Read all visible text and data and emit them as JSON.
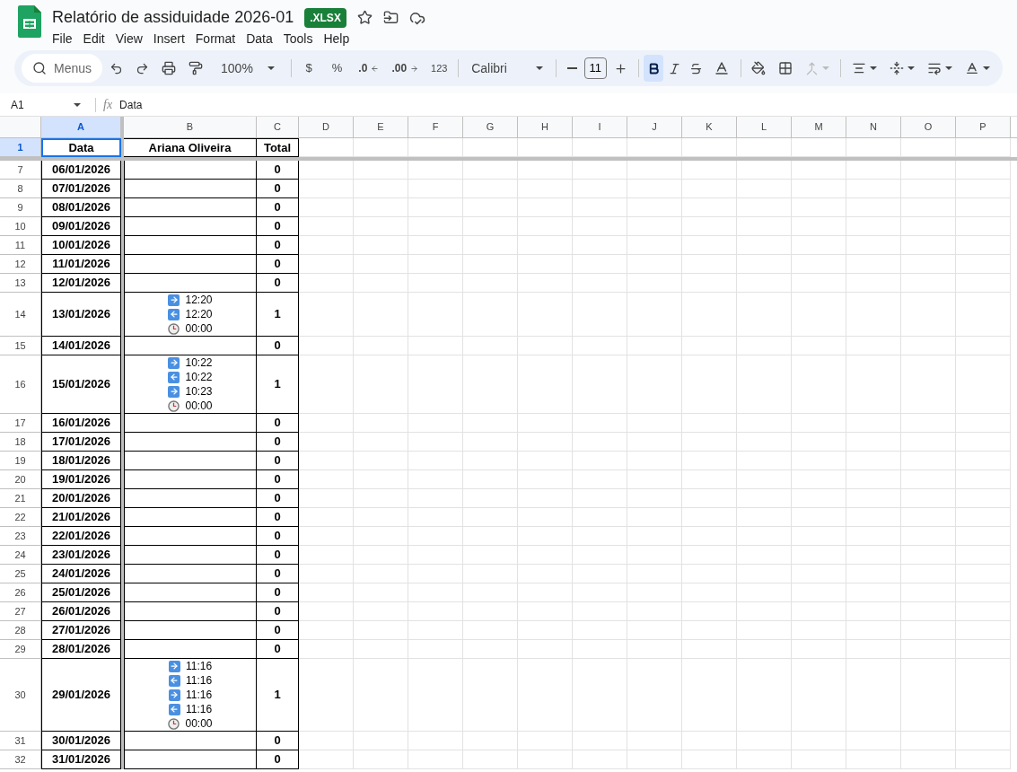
{
  "title": "Relatório de assiduidade 2026-01",
  "file_badge": ".XLSX",
  "menu": [
    "File",
    "Edit",
    "View",
    "Insert",
    "Format",
    "Data",
    "Tools",
    "Help"
  ],
  "toolbar": {
    "search_placeholder": "Menus",
    "zoom": "100%",
    "currency": "$",
    "percent": "%",
    "decrease_decimals": ".0",
    "increase_decimals": ".00",
    "number_format": "123",
    "font": "Calibri",
    "font_size": "11",
    "format_buttons": [
      {
        "kind": "bold",
        "selected": true
      },
      {
        "kind": "italic",
        "selected": false
      },
      {
        "kind": "strikethrough",
        "selected": false
      }
    ]
  },
  "name_box": "A1",
  "function_label": "fx",
  "formula": "Data",
  "columns": [
    {
      "label": "A",
      "selected": true
    },
    {
      "label": "B",
      "selected": false
    },
    {
      "label": "C",
      "selected": false
    },
    {
      "label": "D",
      "selected": false
    },
    {
      "label": "E",
      "selected": false
    },
    {
      "label": "F",
      "selected": false
    },
    {
      "label": "G",
      "selected": false
    },
    {
      "label": "H",
      "selected": false
    },
    {
      "label": "I",
      "selected": false
    },
    {
      "label": "J",
      "selected": false
    },
    {
      "label": "K",
      "selected": false
    },
    {
      "label": "L",
      "selected": false
    },
    {
      "label": "M",
      "selected": false
    },
    {
      "label": "N",
      "selected": false
    },
    {
      "label": "O",
      "selected": false
    },
    {
      "label": "P",
      "selected": false
    }
  ],
  "header_row": {
    "number": "1",
    "selected": true,
    "cells": [
      "Data",
      "Ariana Oliveira",
      "Total"
    ]
  },
  "rows": [
    {
      "number": "7",
      "date": "06/01/2026",
      "total": "0"
    },
    {
      "number": "8",
      "date": "07/01/2026",
      "total": "0"
    },
    {
      "number": "9",
      "date": "08/01/2026",
      "total": "0"
    },
    {
      "number": "10",
      "date": "09/01/2026",
      "total": "0"
    },
    {
      "number": "11",
      "date": "10/01/2026",
      "total": "0"
    },
    {
      "number": "12",
      "date": "11/01/2026",
      "total": "0"
    },
    {
      "number": "13",
      "date": "12/01/2026",
      "total": "0"
    },
    {
      "number": "14",
      "date": "13/01/2026",
      "total": "1",
      "entries": [
        {
          "kind": "in",
          "time": "12:20"
        },
        {
          "kind": "out",
          "time": "12:20"
        },
        {
          "kind": "duration",
          "time": "00:00"
        }
      ]
    },
    {
      "number": "15",
      "date": "14/01/2026",
      "total": "0"
    },
    {
      "number": "16",
      "date": "15/01/2026",
      "total": "1",
      "entries": [
        {
          "kind": "in",
          "time": "10:22"
        },
        {
          "kind": "out",
          "time": "10:22"
        },
        {
          "kind": "in",
          "time": "10:23"
        },
        {
          "kind": "duration",
          "time": "00:00"
        }
      ]
    },
    {
      "number": "17",
      "date": "16/01/2026",
      "total": "0"
    },
    {
      "number": "18",
      "date": "17/01/2026",
      "total": "0"
    },
    {
      "number": "19",
      "date": "18/01/2026",
      "total": "0"
    },
    {
      "number": "20",
      "date": "19/01/2026",
      "total": "0"
    },
    {
      "number": "21",
      "date": "20/01/2026",
      "total": "0"
    },
    {
      "number": "22",
      "date": "21/01/2026",
      "total": "0"
    },
    {
      "number": "23",
      "date": "22/01/2026",
      "total": "0"
    },
    {
      "number": "24",
      "date": "23/01/2026",
      "total": "0"
    },
    {
      "number": "25",
      "date": "24/01/2026",
      "total": "0"
    },
    {
      "number": "26",
      "date": "25/01/2026",
      "total": "0"
    },
    {
      "number": "27",
      "date": "26/01/2026",
      "total": "0"
    },
    {
      "number": "28",
      "date": "27/01/2026",
      "total": "0"
    },
    {
      "number": "29",
      "date": "28/01/2026",
      "total": "0"
    },
    {
      "number": "30",
      "date": "29/01/2026",
      "total": "1",
      "entries": [
        {
          "kind": "in",
          "time": "11:16"
        },
        {
          "kind": "out",
          "time": "11:16"
        },
        {
          "kind": "in",
          "time": "11:16"
        },
        {
          "kind": "out",
          "time": "11:16"
        },
        {
          "kind": "duration",
          "time": "00:00"
        }
      ]
    },
    {
      "number": "31",
      "date": "30/01/2026",
      "total": "0"
    },
    {
      "number": "32",
      "date": "31/01/2026",
      "total": "0"
    }
  ]
}
